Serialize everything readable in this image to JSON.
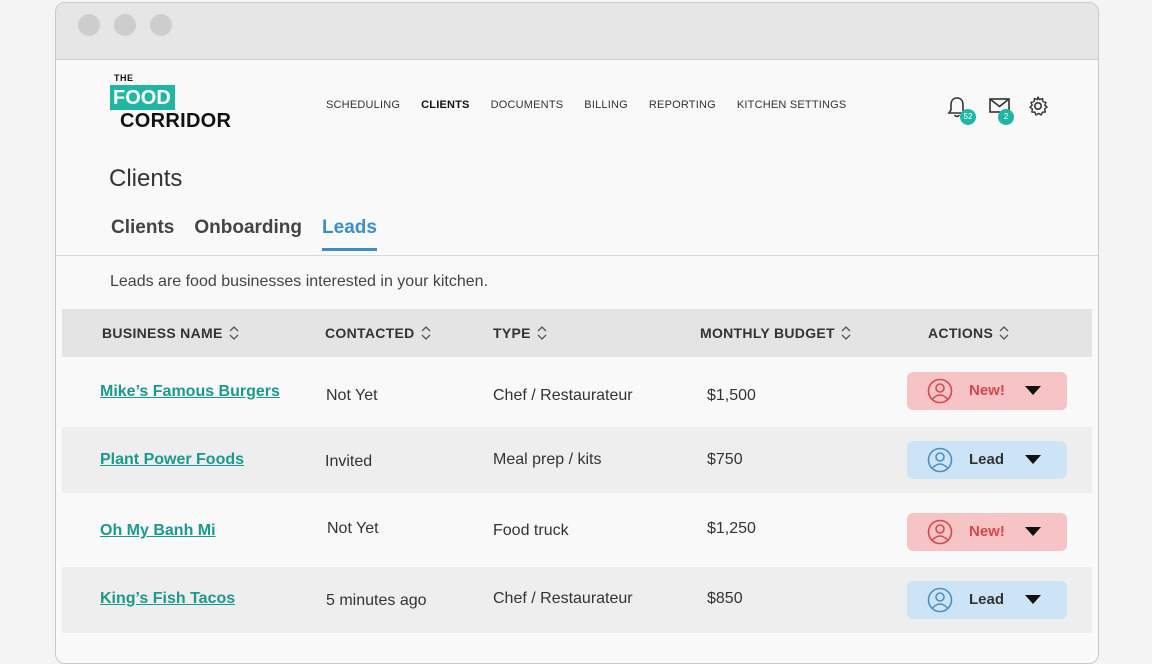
{
  "logo": {
    "the": "THE",
    "food": "FOOD",
    "corridor": "CORRIDOR"
  },
  "nav": {
    "items": [
      {
        "label": "SCHEDULING",
        "active": false
      },
      {
        "label": "CLIENTS",
        "active": true
      },
      {
        "label": "DOCUMENTS",
        "active": false
      },
      {
        "label": "BILLING",
        "active": false
      },
      {
        "label": "REPORTING",
        "active": false
      },
      {
        "label": "KITCHEN SETTINGS",
        "active": false
      }
    ]
  },
  "header_icons": {
    "notifications": {
      "icon": "bell-icon",
      "count": "52"
    },
    "messages": {
      "icon": "envelope-icon",
      "count": "2"
    },
    "settings": {
      "icon": "gear-icon"
    }
  },
  "page": {
    "title": "Clients",
    "tabs": [
      {
        "label": "Clients",
        "active": false
      },
      {
        "label": "Onboarding",
        "active": false
      },
      {
        "label": "Leads",
        "active": true
      }
    ],
    "description": "Leads are food businesses interested in your kitchen."
  },
  "table": {
    "headers": [
      "BUSINESS NAME",
      "CONTACTED",
      "TYPE",
      "MONTHLY BUDGET",
      "ACTIONS"
    ],
    "rows": [
      {
        "name": "Mike’s Famous Burgers",
        "contacted": "Not Yet",
        "type": "Chef / Restaurateur",
        "budget": "$1,500",
        "status": "New!"
      },
      {
        "name": "Plant Power Foods",
        "contacted": "Invited",
        "type": "Meal prep / kits",
        "budget": "$750",
        "status": "Lead"
      },
      {
        "name": "Oh My Banh Mi",
        "contacted": "Not Yet",
        "type": "Food truck",
        "budget": "$1,250",
        "status": "New!"
      },
      {
        "name": "King’s Fish Tacos",
        "contacted": "5 minutes ago",
        "type": "Chef / Restaurateur",
        "budget": "$850",
        "status": "Lead"
      }
    ]
  },
  "colors": {
    "accent": "#1fb7a3",
    "tab_active": "#3a8fc9",
    "new_bg": "#f7c4c6",
    "new_text": "#d9454d",
    "lead_bg": "#cde4f6"
  }
}
